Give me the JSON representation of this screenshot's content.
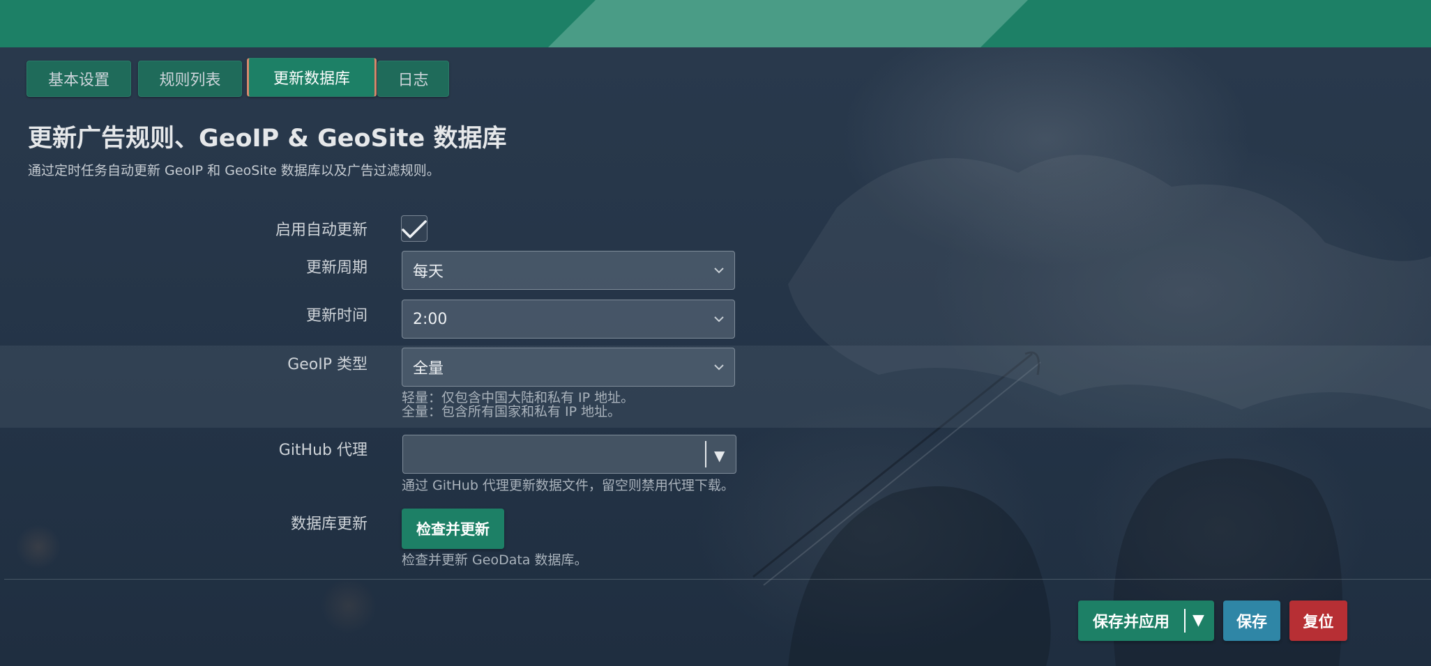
{
  "tabs": [
    {
      "label": "基本设置",
      "active": false
    },
    {
      "label": "规则列表",
      "active": false
    },
    {
      "label": "更新数据库",
      "active": true
    },
    {
      "label": "日志",
      "active": false
    }
  ],
  "page": {
    "title": "更新广告规则、GeoIP & GeoSite 数据库",
    "description": "通过定时任务自动更新 GeoIP 和 GeoSite 数据库以及广告过滤规则。"
  },
  "form": {
    "auto_update": {
      "label": "启用自动更新",
      "checked": true
    },
    "update_period": {
      "label": "更新周期",
      "value": "每天"
    },
    "update_time": {
      "label": "更新时间",
      "value": "2:00"
    },
    "geoip_type": {
      "label": "GeoIP 类型",
      "value": "全量",
      "hint_lite": "轻量：仅包含中国大陆和私有 IP 地址。",
      "hint_full": "全量：包含所有国家和私有 IP 地址。"
    },
    "github_proxy": {
      "label": "GitHub 代理",
      "value": "",
      "hint": "通过 GitHub 代理更新数据文件，留空则禁用代理下载。",
      "arrow": "▼"
    },
    "db_update": {
      "label": "数据库更新",
      "button": "检查并更新",
      "hint": "检查并更新 GeoData 数据库。"
    }
  },
  "footer": {
    "save_apply": "保存并应用",
    "save_apply_arrow": "▼",
    "save": "保存",
    "reset": "复位"
  },
  "colors": {
    "primary": "#1d8066",
    "save": "#2f86a6",
    "reset": "#b72f34",
    "tab_active_border": "#d98a6d"
  }
}
